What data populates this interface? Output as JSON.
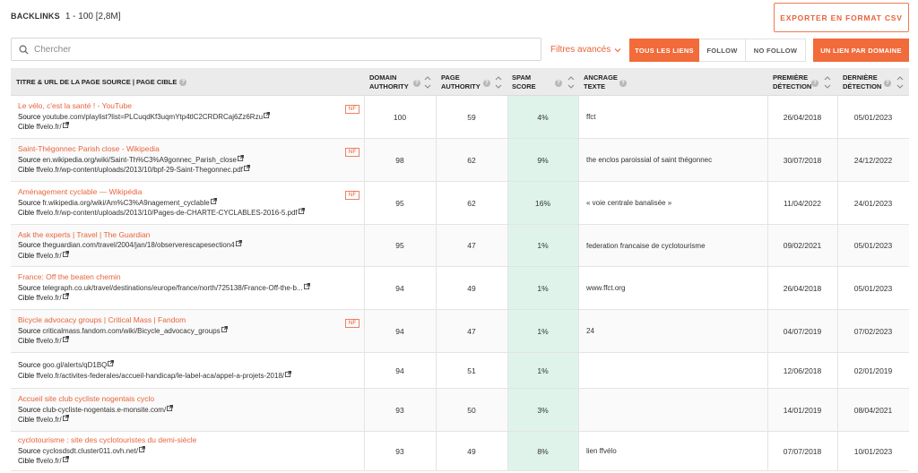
{
  "header": {
    "label": "BACKLINKS",
    "range": "1 - 100 [2,8M]"
  },
  "export_label": "EXPORTER EN FORMAT CSV",
  "search": {
    "placeholder": "Chercher",
    "value": ""
  },
  "filters_label": "Filtres avancés",
  "segments": {
    "all": "TOUS LES LIENS",
    "follow": "FOLLOW",
    "nofollow": "NO FOLLOW",
    "per_domain": "UN LIEN PAR DOMAINE"
  },
  "columns": {
    "source": "TITRE & URL DE LA PAGE SOURCE | PAGE CIBLE",
    "da_1": "DOMAIN",
    "da_2": "AUTHORITY",
    "pa_1": "PAGE",
    "pa_2": "AUTHORITY",
    "spam_1": "SPAM",
    "spam_2": "SCORE",
    "anchor_1": "ANCRAGE",
    "anchor_2": "TEXTE",
    "first_1": "PREMIÈRE",
    "first_2": "DÉTECTION",
    "last_1": "DERNIÈRE",
    "last_2": "DÉTECTION"
  },
  "labels": {
    "source": "Source",
    "cible": "Cible",
    "nf": "NF"
  },
  "rows": [
    {
      "title": "Le vélo, c'est la santé ! - YouTube",
      "source": "youtube.com/playlist?list=PLCuqdKf3uqmYtp4tlC2CRDRCaj6Zz6Rzu",
      "cible": "ffvelo.fr/",
      "nf": true,
      "da": "100",
      "pa": "59",
      "spam": "4%",
      "anchor": "ffct",
      "first": "26/04/2018",
      "last": "05/01/2023"
    },
    {
      "title": "Saint-Thégonnec Parish close - Wikipedia",
      "source": "en.wikipedia.org/wiki/Saint-Th%C3%A9gonnec_Parish_close",
      "cible": "ffvelo.fr/wp-content/uploads/2013/10/bpf-29-Saint-Thegonnec.pdf",
      "nf": true,
      "da": "98",
      "pa": "62",
      "spam": "9%",
      "anchor": "the enclos paroissial of saint thégonnec",
      "first": "30/07/2018",
      "last": "24/12/2022"
    },
    {
      "title": "Aménagement cyclable — Wikipédia",
      "source": "fr.wikipedia.org/wiki/Am%C3%A9nagement_cyclable",
      "cible": "ffvelo.fr/wp-content/uploads/2013/10/Pages-de-CHARTE-CYCLABLES-2016-5.pdf",
      "nf": true,
      "da": "95",
      "pa": "62",
      "spam": "16%",
      "anchor": "« voie centrale banalisée »",
      "first": "11/04/2022",
      "last": "24/01/2023"
    },
    {
      "title": "Ask the experts | Travel | The Guardian",
      "source": "theguardian.com/travel/2004/jan/18/observerescapesection4",
      "cible": "ffvelo.fr/",
      "nf": false,
      "da": "95",
      "pa": "47",
      "spam": "1%",
      "anchor": "federation francaise de cyclotourisme",
      "first": "09/02/2021",
      "last": "05/01/2023"
    },
    {
      "title": "France: Off the beaten chemin",
      "source": "telegraph.co.uk/travel/destinations/europe/france/north/725138/France-Off-the-b...",
      "cible": "ffvelo.fr/",
      "nf": false,
      "da": "94",
      "pa": "49",
      "spam": "1%",
      "anchor": "www.ffct.org",
      "first": "26/04/2018",
      "last": "05/01/2023"
    },
    {
      "title": "Bicycle advocacy groups | Critical Mass | Fandom",
      "source": "criticalmass.fandom.com/wiki/Bicycle_advocacy_groups",
      "cible": "ffvelo.fr/",
      "nf": true,
      "da": "94",
      "pa": "47",
      "spam": "1%",
      "anchor": "24",
      "first": "04/07/2019",
      "last": "07/02/2023"
    },
    {
      "title": "",
      "source": "goo.gl/alerts/qD1BQ",
      "cible": "ffvelo.fr/activites-federales/accueil-handicap/le-label-aca/appel-a-projets-2018/",
      "nf": false,
      "da": "94",
      "pa": "51",
      "spam": "1%",
      "anchor": "",
      "first": "12/06/2018",
      "last": "02/01/2019"
    },
    {
      "title": "Accueil site club cycliste nogentais cyclo",
      "source": "club-cycliste-nogentais.e-monsite.com/",
      "cible": "ffvelo.fr/",
      "nf": false,
      "da": "93",
      "pa": "50",
      "spam": "3%",
      "anchor": "",
      "first": "14/01/2019",
      "last": "08/04/2021"
    },
    {
      "title": "cyclotourisme : site des cyclotouristes du demi-siècle",
      "source": "cyclosdsdt.cluster011.ovh.net/",
      "cible": "ffvelo.fr/",
      "nf": false,
      "da": "93",
      "pa": "49",
      "spam": "8%",
      "anchor": "lien ffvélo",
      "first": "07/07/2018",
      "last": "10/01/2023"
    }
  ]
}
